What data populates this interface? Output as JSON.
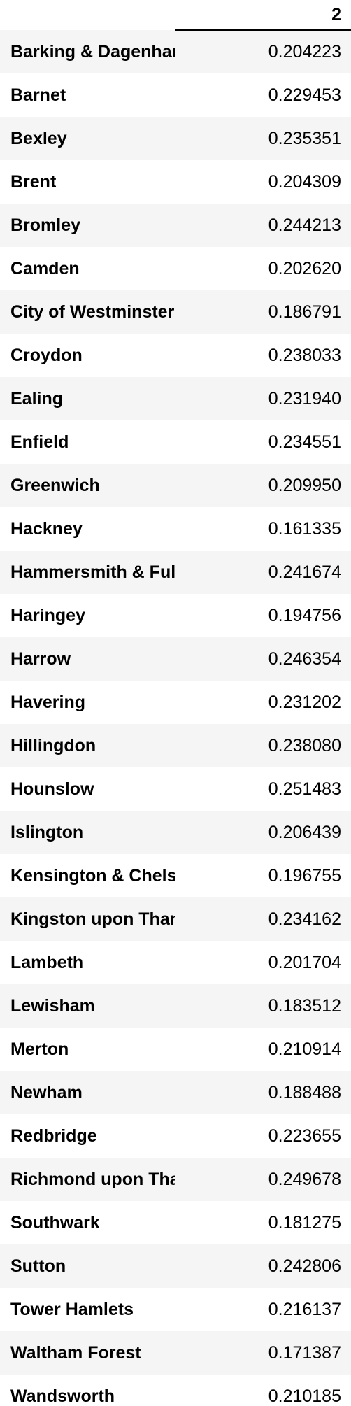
{
  "table": {
    "column_header": "2",
    "rows": [
      {
        "label": "Barking & Dagenham",
        "value": "0.204223"
      },
      {
        "label": "Barnet",
        "value": "0.229453"
      },
      {
        "label": "Bexley",
        "value": "0.235351"
      },
      {
        "label": "Brent",
        "value": "0.204309"
      },
      {
        "label": "Bromley",
        "value": "0.244213"
      },
      {
        "label": "Camden",
        "value": "0.202620"
      },
      {
        "label": "City of Westminster",
        "value": "0.186791"
      },
      {
        "label": "Croydon",
        "value": "0.238033"
      },
      {
        "label": "Ealing",
        "value": "0.231940"
      },
      {
        "label": "Enfield",
        "value": "0.234551"
      },
      {
        "label": "Greenwich",
        "value": "0.209950"
      },
      {
        "label": "Hackney",
        "value": "0.161335"
      },
      {
        "label": "Hammersmith & Fulham",
        "value": "0.241674"
      },
      {
        "label": "Haringey",
        "value": "0.194756"
      },
      {
        "label": "Harrow",
        "value": "0.246354"
      },
      {
        "label": "Havering",
        "value": "0.231202"
      },
      {
        "label": "Hillingdon",
        "value": "0.238080"
      },
      {
        "label": "Hounslow",
        "value": "0.251483"
      },
      {
        "label": "Islington",
        "value": "0.206439"
      },
      {
        "label": "Kensington & Chelsea",
        "value": "0.196755"
      },
      {
        "label": "Kingston upon Thames",
        "value": "0.234162"
      },
      {
        "label": "Lambeth",
        "value": "0.201704"
      },
      {
        "label": "Lewisham",
        "value": "0.183512"
      },
      {
        "label": "Merton",
        "value": "0.210914"
      },
      {
        "label": "Newham",
        "value": "0.188488"
      },
      {
        "label": "Redbridge",
        "value": "0.223655"
      },
      {
        "label": "Richmond upon Thames",
        "value": "0.249678"
      },
      {
        "label": "Southwark",
        "value": "0.181275"
      },
      {
        "label": "Sutton",
        "value": "0.242806"
      },
      {
        "label": "Tower Hamlets",
        "value": "0.216137"
      },
      {
        "label": "Waltham Forest",
        "value": "0.171387"
      },
      {
        "label": "Wandsworth",
        "value": "0.210185"
      }
    ]
  }
}
